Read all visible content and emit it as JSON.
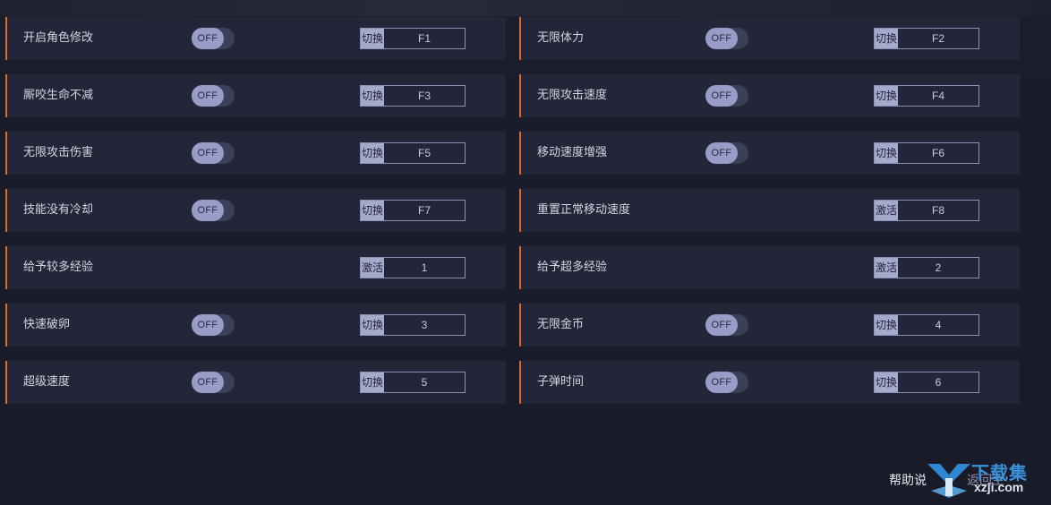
{
  "rows": [
    {
      "label": "开启角色修改",
      "toggle": "OFF",
      "mode": "切换",
      "key": "F1"
    },
    {
      "label": "无限体力",
      "toggle": "OFF",
      "mode": "切换",
      "key": "F2"
    },
    {
      "label": "厮咬生命不减",
      "toggle": "OFF",
      "mode": "切换",
      "key": "F3"
    },
    {
      "label": "无限攻击速度",
      "toggle": "OFF",
      "mode": "切换",
      "key": "F4"
    },
    {
      "label": "无限攻击伤害",
      "toggle": "OFF",
      "mode": "切换",
      "key": "F5"
    },
    {
      "label": "移动速度增强",
      "toggle": "OFF",
      "mode": "切换",
      "key": "F6"
    },
    {
      "label": "技能没有冷却",
      "toggle": "OFF",
      "mode": "切换",
      "key": "F7"
    },
    {
      "label": "重置正常移动速度",
      "toggle": null,
      "mode": "激活",
      "key": "F8"
    },
    {
      "label": "给予较多经验",
      "toggle": null,
      "mode": "激活",
      "key": "1"
    },
    {
      "label": "给予超多经验",
      "toggle": null,
      "mode": "激活",
      "key": "2"
    },
    {
      "label": "快速破卵",
      "toggle": "OFF",
      "mode": "切换",
      "key": "3"
    },
    {
      "label": "无限金币",
      "toggle": "OFF",
      "mode": "切换",
      "key": "4"
    },
    {
      "label": "超级速度",
      "toggle": "OFF",
      "mode": "切换",
      "key": "5"
    },
    {
      "label": "子弹时间",
      "toggle": "OFF",
      "mode": "切换",
      "key": "6"
    }
  ],
  "footer": {
    "help_label": "帮助说",
    "back_label": "返回主"
  },
  "watermark": {
    "text": "下载集",
    "sub": "xzji.com"
  },
  "colors": {
    "accent": "#e0682c",
    "row_bg": "#232538",
    "page_bg": "#1a1c2b",
    "toggle_knob": "#9a9cc7",
    "hotkey_mode_bg": "#a6a8cc",
    "watermark_blue": "#3a92d8"
  },
  "icons": {
    "watermark_logo": "download-arrow-logo-icon"
  }
}
